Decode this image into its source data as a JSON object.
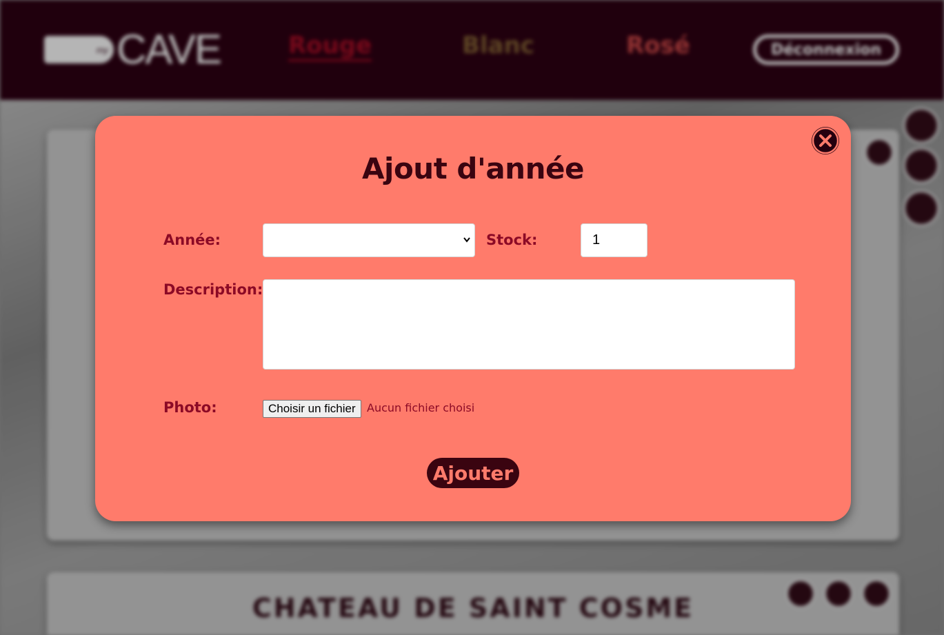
{
  "header": {
    "logo_small": "my",
    "logo_text": "CAVE",
    "nav": [
      "Rouge",
      "Blanc",
      "Rosé"
    ],
    "logout_label": "Déconnexion"
  },
  "background": {
    "card_title": "CHATEAU DE SAINT COSME"
  },
  "modal": {
    "title": "Ajout d'année",
    "year_label": "Année:",
    "year_value": "",
    "stock_label": "Stock:",
    "stock_value": "1",
    "description_label": "Description:",
    "description_value": "",
    "photo_label": "Photo:",
    "file_button_label": "Choisir un fichier",
    "file_status": "Aucun fichier choisi",
    "submit_label": "Ajouter"
  },
  "colors": {
    "modal_bg": "#ff7b6b",
    "navbar_bg": "#25000f",
    "label_color": "#8c0a26",
    "title_color": "#3a0410"
  }
}
